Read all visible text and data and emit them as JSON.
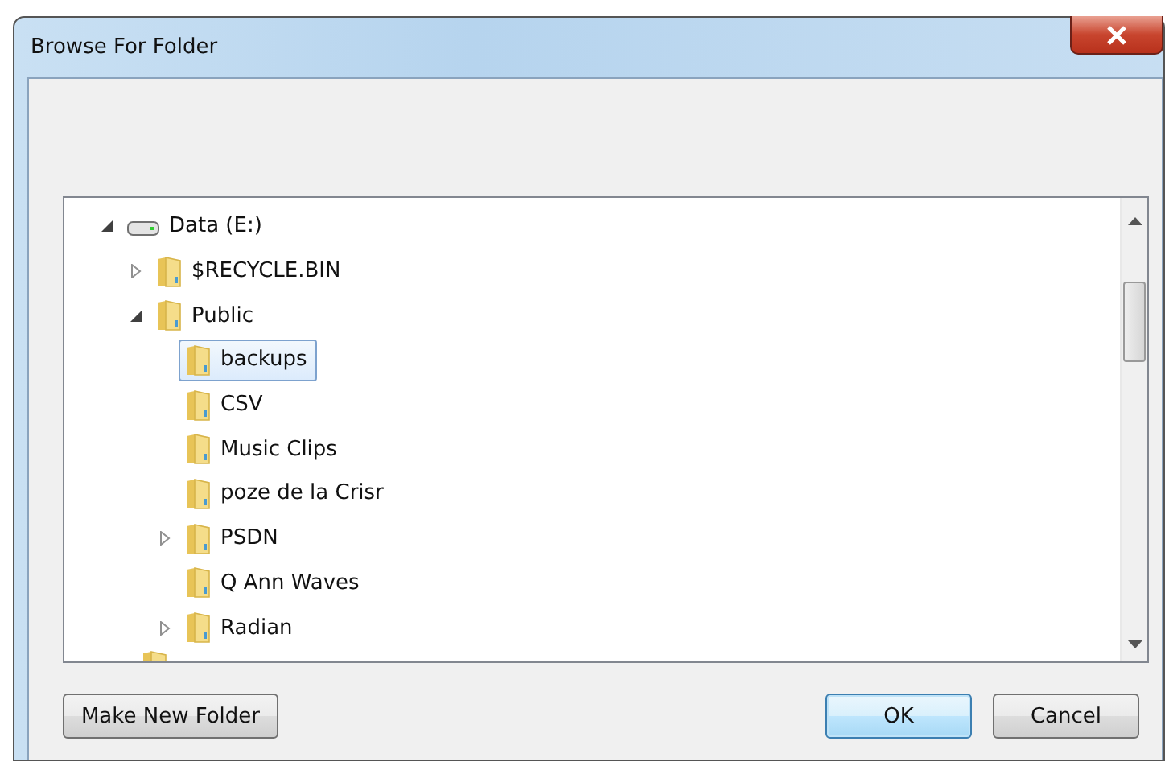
{
  "window": {
    "title": "Browse For Folder"
  },
  "tree": {
    "items": [
      {
        "kind": "drive",
        "label": "Data (E:)",
        "expanded": true,
        "selected": false,
        "children": [
          {
            "kind": "folder",
            "label": "$RECYCLE.BIN",
            "expanded": false,
            "selected": false
          },
          {
            "kind": "folder",
            "label": "Public",
            "expanded": true,
            "selected": false,
            "children": [
              {
                "kind": "folder",
                "label": "backups",
                "selected": true
              },
              {
                "kind": "folder",
                "label": "CSV",
                "selected": false
              },
              {
                "kind": "folder",
                "label": "Music Clips",
                "selected": false
              },
              {
                "kind": "folder",
                "label": "poze de la Crisr",
                "selected": false
              },
              {
                "kind": "folder",
                "label": "PSDN",
                "expanded": false,
                "selected": false
              },
              {
                "kind": "folder",
                "label": "Q Ann Waves",
                "selected": false
              },
              {
                "kind": "folder",
                "label": "Radian",
                "expanded": false,
                "selected": false
              }
            ]
          }
        ]
      }
    ]
  },
  "buttons": [
    {
      "kind": "left",
      "label": "Make New Folder",
      "default": false
    },
    {
      "kind": "right",
      "label": "OK",
      "default": true
    },
    {
      "kind": "right",
      "label": "Cancel",
      "default": false
    }
  ]
}
